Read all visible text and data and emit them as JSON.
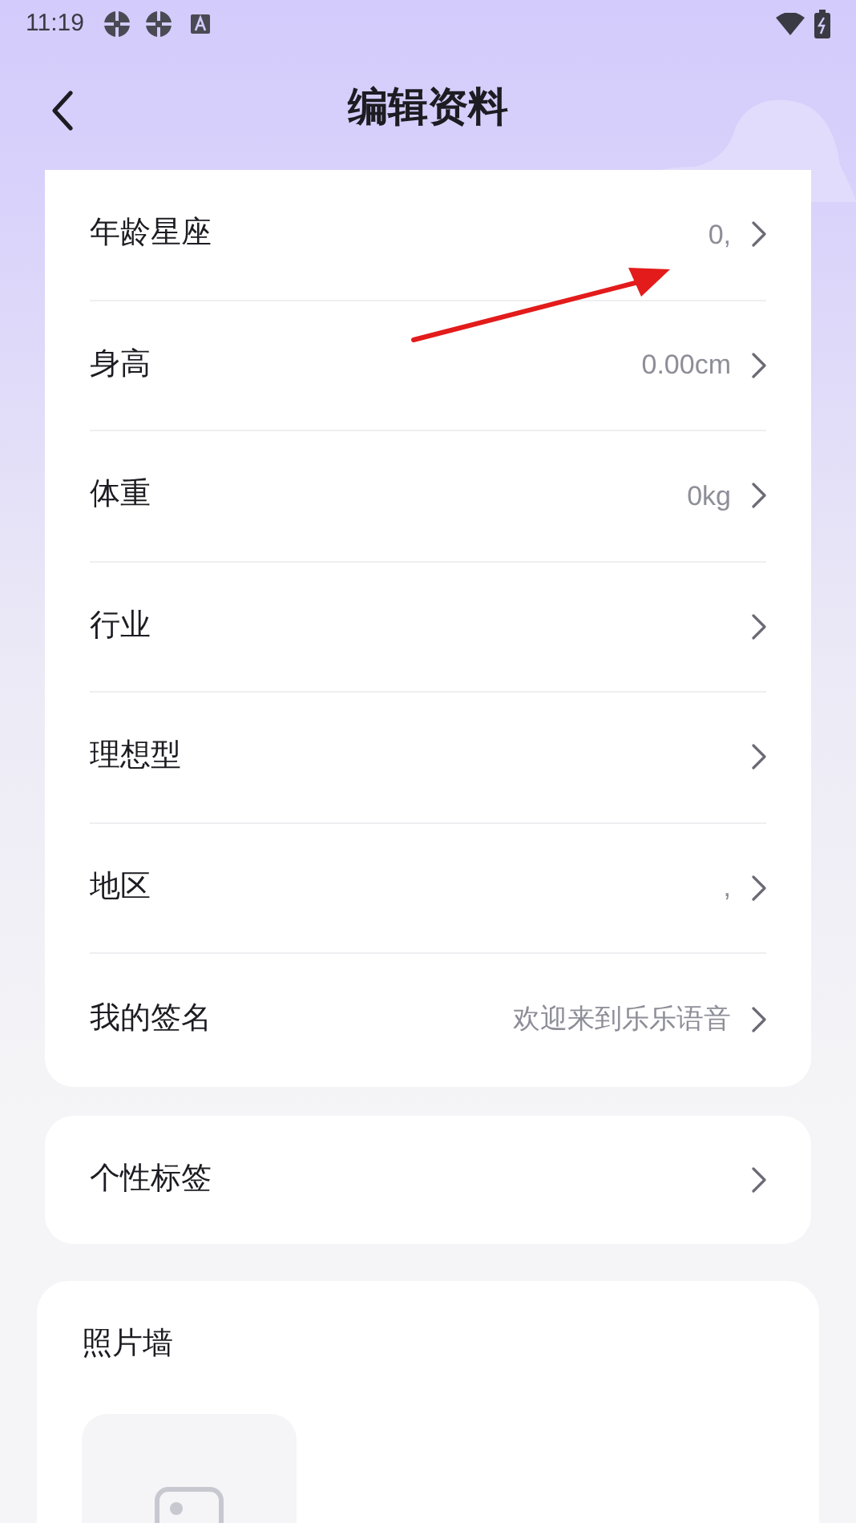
{
  "status_bar": {
    "time": "11:19"
  },
  "header": {
    "title": "编辑资料"
  },
  "profile_rows": [
    {
      "label": "年龄星座",
      "value": "0,"
    },
    {
      "label": "身高",
      "value": "0.00cm"
    },
    {
      "label": "体重",
      "value": "0kg"
    },
    {
      "label": "行业"
    },
    {
      "label": "理想型"
    },
    {
      "label": "地区",
      "value": ","
    },
    {
      "label": "我的签名",
      "value": "欢迎来到乐乐语音"
    }
  ],
  "tags_row": {
    "label": "个性标签"
  },
  "photo_wall": {
    "title": "照片墙"
  }
}
